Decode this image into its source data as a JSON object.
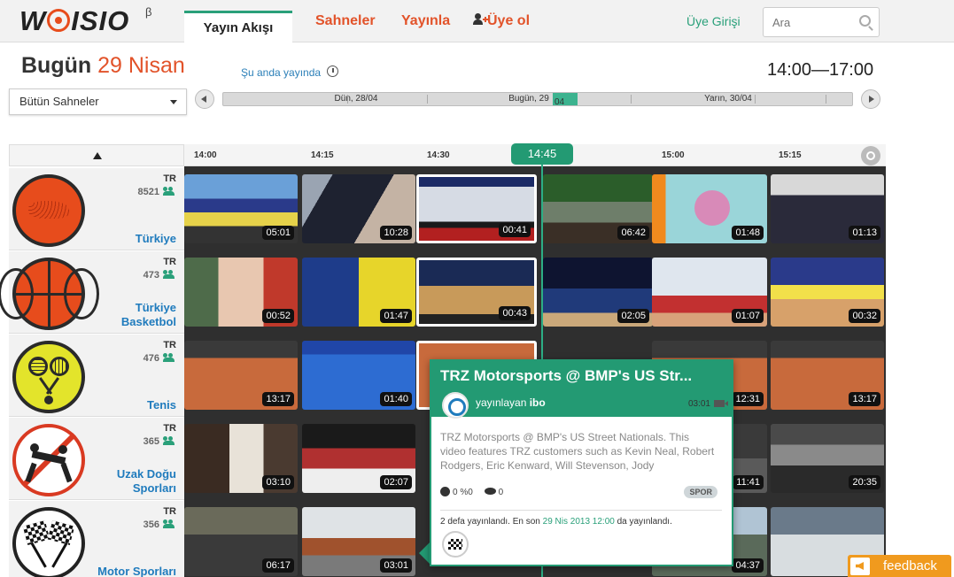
{
  "header": {
    "logo": "WOISIO",
    "beta": "β",
    "tab_active": "Yayın Akışı",
    "nav": [
      {
        "label": "Sahneler",
        "name": "nav-scenes"
      },
      {
        "label": "Yayınla",
        "name": "nav-publish"
      },
      {
        "label": "Üye ol",
        "name": "nav-signup"
      }
    ],
    "login": "Üye Girişi",
    "search_placeholder": "Ara"
  },
  "date_bar": {
    "today_label": "Bugün",
    "today_date": "29 Nisan",
    "live_link": "Şu anda yayında",
    "time_range": "14:00—17:00",
    "scene_select": "Bütün Sahneler",
    "scroller": {
      "yesterday": "Dün, 28/04",
      "today": "Bugün, 29",
      "today_thumb": "04",
      "tomorrow": "Yarın, 30/04"
    }
  },
  "timeline": {
    "labels": [
      "14:00",
      "14:15",
      "14:30",
      "15:00",
      "15:15"
    ],
    "now": "14:45"
  },
  "colors": {
    "accent": "#239a73",
    "brand": "#e2532a",
    "link": "#1f7bbd"
  },
  "channels": [
    {
      "name": "Türkiye",
      "country": "TR",
      "count": "8521",
      "icon": "turkey-map-icon",
      "durations": [
        "05:01",
        "10:28",
        "00:41",
        "06:42",
        "01:48",
        "01:13"
      ]
    },
    {
      "name": "Türkiye Basketbol",
      "country": "TR",
      "count": "473",
      "icon": "basketball-icon",
      "durations": [
        "00:52",
        "01:47",
        "00:43",
        "02:05",
        "01:07",
        "00:32"
      ]
    },
    {
      "name": "Tenis",
      "country": "TR",
      "count": "476",
      "icon": "tennis-icon",
      "durations": [
        "13:17",
        "01:40",
        "",
        "",
        "12:31",
        "13:17"
      ]
    },
    {
      "name": "Uzak Doğu Sporları",
      "country": "TR",
      "count": "365",
      "icon": "martial-arts-icon",
      "durations": [
        "03:10",
        "02:07",
        "",
        "",
        "11:41",
        "20:35"
      ]
    },
    {
      "name": "Motor Sporları",
      "country": "TR",
      "count": "356",
      "icon": "checkered-flags-icon",
      "durations": [
        "06:17",
        "03:01",
        "",
        "",
        "04:37",
        ""
      ]
    }
  ],
  "popup": {
    "title": "TRZ Motorsports @ BMP's US Str...",
    "published_by_label": "yayınlayan",
    "publisher": "ibo",
    "duration": "03:01",
    "description": "TRZ Motorsports @ BMP's US Street Nationals. This video features TRZ customers such as Kevin Neal, Robert Rodgers, Eric Kenward, Will Stevenson, Jody",
    "rating": "0 %0",
    "views": "0",
    "tag": "SPOR",
    "history_prefix": "2 defa yayınlandı. En son",
    "history_date": "29 Nis 2013 12:00",
    "history_suffix": "da yayınlandı."
  },
  "feedback": "feedback"
}
